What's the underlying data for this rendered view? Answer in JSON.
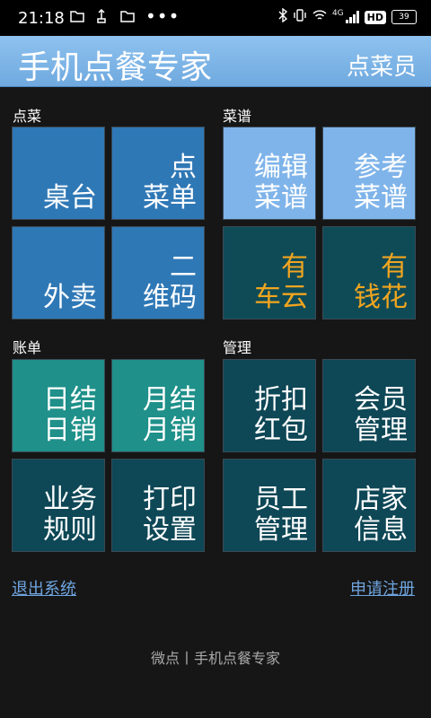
{
  "status": {
    "time": "21:18",
    "network": "4G",
    "hd": "HD",
    "battery": "39"
  },
  "header": {
    "title": "手机点餐专家",
    "role": "点菜员"
  },
  "sections": {
    "order": "点菜",
    "menu": "菜谱",
    "bills": "账单",
    "manage": "管理"
  },
  "tiles": {
    "table": "桌台",
    "order_list": "点\n菜单",
    "takeout": "外卖",
    "qr_code": "二\n维码",
    "edit_menu": "编辑\n菜谱",
    "ref_menu": "参考\n菜谱",
    "cloud": "有\n车云",
    "money_flower": "有\n钱花",
    "daily": "日结\n日销",
    "monthly": "月结\n月销",
    "discount": "折扣\n红包",
    "members": "会员\n管理",
    "rules": "业务\n规则",
    "print": "打印\n设置",
    "staff": "员工\n管理",
    "store": "店家\n信息"
  },
  "links": {
    "logout": "退出系统",
    "register": "申请注册"
  },
  "footer": "微点丨手机点餐专家",
  "colors": {
    "blue_tile": "#2f78b6",
    "light_tile": "#7fb4ea",
    "dark_teal_tile": "#0f4b57",
    "teal_tile": "#1f908a",
    "accent_text": "#f1a51f",
    "link": "#6fa5e0"
  }
}
